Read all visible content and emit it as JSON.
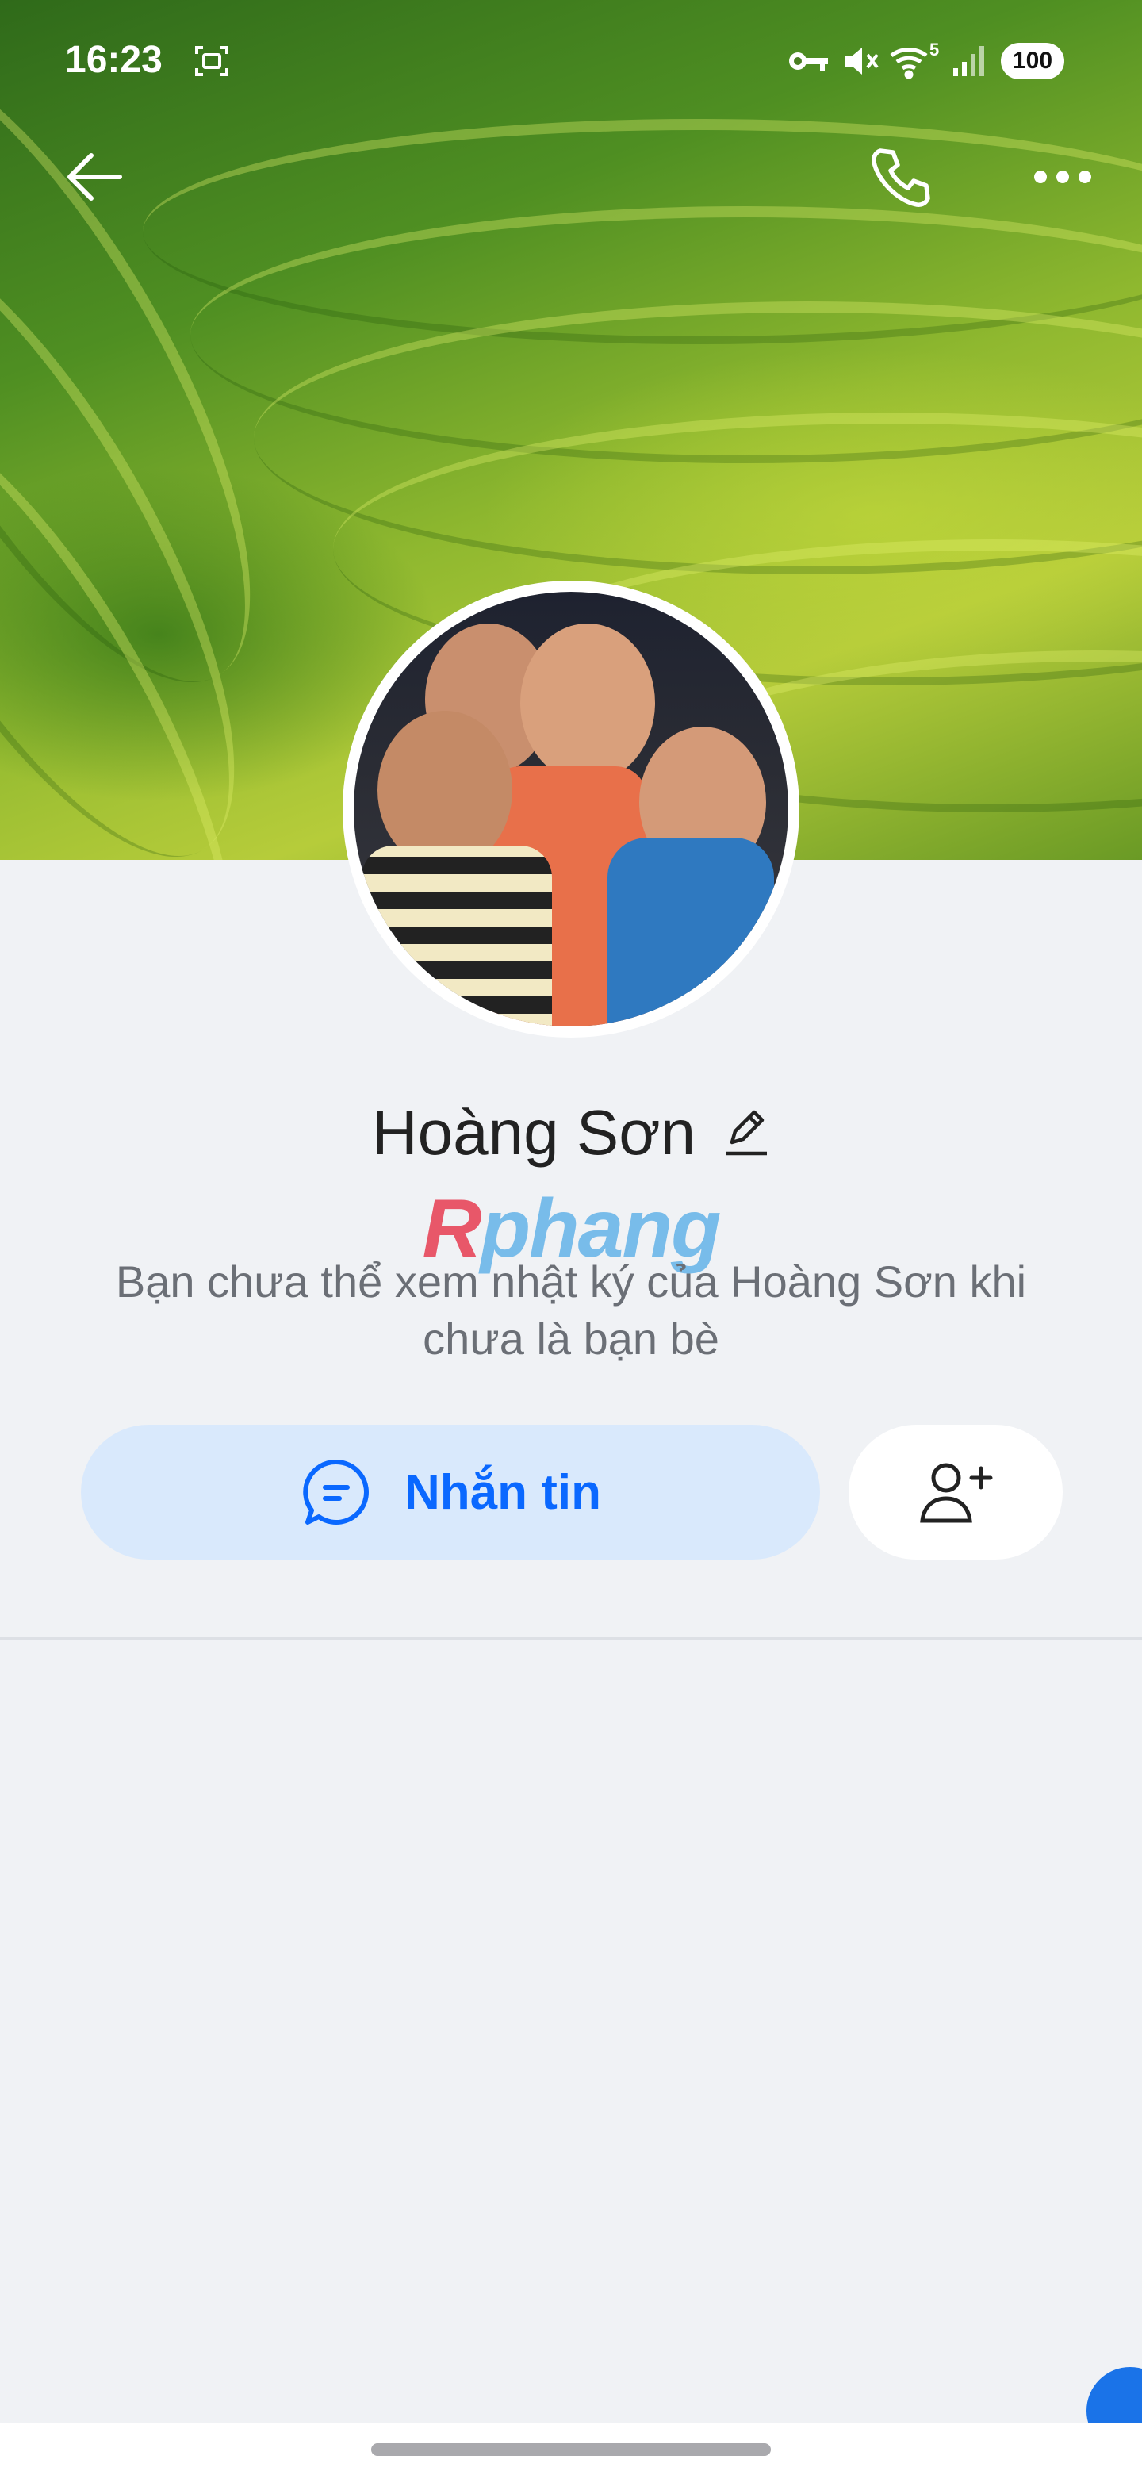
{
  "status_bar": {
    "time": "16:23",
    "battery": "100",
    "network_sup": "5"
  },
  "top_bar": {
    "back_icon": "arrow-left-icon",
    "call_icon": "phone-icon",
    "more_icon": "more-horizontal-icon"
  },
  "profile": {
    "name": "Hoàng Sơn",
    "edit_icon": "pencil-icon",
    "info_text": "Bạn chưa thể xem nhật ký của Hoàng Sơn khi chưa là bạn bè"
  },
  "watermark": {
    "first": "R",
    "rest": "phang"
  },
  "actions": {
    "message_label": "Nhắn tin",
    "message_icon": "chat-bubble-icon",
    "add_friend_icon": "user-plus-icon"
  },
  "colors": {
    "accent": "#0a68ff",
    "message_button_bg": "#d9e9fc",
    "page_bg": "#f0f2f5"
  }
}
